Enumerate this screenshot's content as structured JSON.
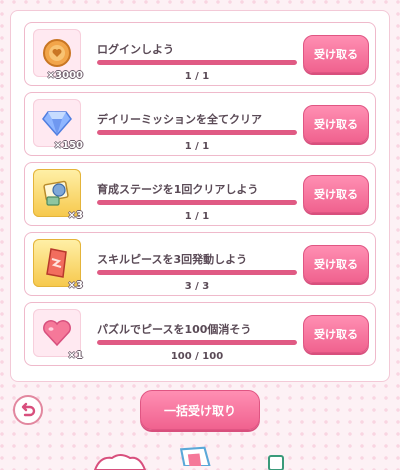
{
  "missions": [
    {
      "icon": "coin-icon",
      "quantity": "×3000",
      "title": "ログインしよう",
      "progress_text": "1 / 1",
      "progress": 1.0,
      "claim_label": "受け取る"
    },
    {
      "icon": "diamond-icon",
      "quantity": "×150",
      "title": "デイリーミッションを全てクリア",
      "progress_text": "1 / 1",
      "progress": 1.0,
      "claim_label": "受け取る"
    },
    {
      "icon": "training-ticket-icon",
      "quantity": "×3",
      "title": "育成ステージを1回クリアしよう",
      "progress_text": "1 / 1",
      "progress": 1.0,
      "claim_label": "受け取る"
    },
    {
      "icon": "skill-ticket-icon",
      "quantity": "×3",
      "title": "スキルピースを3回発動しよう",
      "progress_text": "3 / 3",
      "progress": 1.0,
      "claim_label": "受け取る"
    },
    {
      "icon": "heart-icon",
      "quantity": "×1",
      "title": "パズルでピースを100個消そう",
      "progress_text": "100 / 100",
      "progress": 1.0,
      "claim_label": "受け取る"
    }
  ],
  "footer": {
    "bulk_claim_label": "一括受け取り",
    "back_icon": "back-arrow-icon"
  },
  "colors": {
    "accent": "#f0628f",
    "bar_fill": "#e05a84",
    "text": "#5a4a56"
  }
}
